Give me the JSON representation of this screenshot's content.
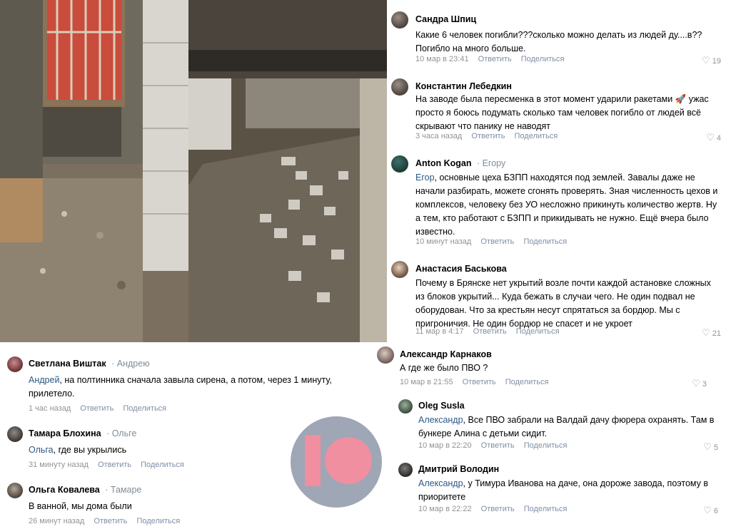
{
  "comments_right": [
    {
      "name": "Сандра Шпиц",
      "reply_to": "",
      "mention": "",
      "text": "Какие 6 человек погибли???сколько можно делать из людей ду....в?? Погибло на много больше.",
      "time": "10 мар в 23:41",
      "reply": "Ответить",
      "share": "Поделиться",
      "likes": "19"
    },
    {
      "name": "Константин Лебедкин",
      "reply_to": "",
      "mention": "",
      "text": "На заводе была пересменка в этот момент ударили ракетами 🚀 ужас просто я боюсь подумать сколько там человек погибло от людей всё скрывают что панику не наводят",
      "time": "3 часа назад",
      "reply": "Ответить",
      "share": "Поделиться",
      "likes": "4"
    },
    {
      "name": "Anton Kogan",
      "reply_to": "Егору",
      "mention": "Егор",
      "text": ", основные цеха БЗПП находятся под землей. Завалы даже не начали разбирать, можете сгонять проверять. Зная численность цехов и комплексов, человеку без УО несложно прикинуть количество жертв. Ну а тем, кто работают с БЗПП и прикидывать не нужно. Ещё вчера было известно.",
      "time": "10 минут назад",
      "reply": "Ответить",
      "share": "Поделиться",
      "likes": ""
    },
    {
      "name": "Анастасия Баськова",
      "reply_to": "",
      "mention": "",
      "text": "Почему в Брянске нет укрытий возле почти каждой астановке сложных из блоков укрытий... Куда бежать в случаи чего. Не один подвал не оборудован. Что за крестьян несут спрятаться за бордюр. Мы с пригроничия. Не один бордюр не спасет и не укроет",
      "time": "11 мар в 4:17",
      "reply": "Ответить",
      "share": "Поделиться",
      "likes": "21"
    },
    {
      "name": "Александр Карнаков",
      "reply_to": "",
      "mention": "",
      "text": "А где же было ПВО ?",
      "time": "10 мар в 21:55",
      "reply": "Ответить",
      "share": "Поделиться",
      "likes": "3"
    },
    {
      "name": "Oleg Susla",
      "reply_to": "",
      "mention": "Александр",
      "text": ", Все ПВО забрали на Валдай дачу фюрера охранять. Там в бункере Алина с детьми сидит.",
      "time": "10 мар в 22:20",
      "reply": "Ответить",
      "share": "Поделиться",
      "likes": "5"
    },
    {
      "name": "Дмитрий Володин",
      "reply_to": "",
      "mention": "Александр",
      "text": ", у Тимура Иванова на даче, она дороже завода, поэтому в приоритете",
      "time": "10 мар в 22:22",
      "reply": "Ответить",
      "share": "Поделиться",
      "likes": "6"
    }
  ],
  "comments_left": [
    {
      "name": "Светлана Виштак",
      "reply_to": "Андрею",
      "mention": "Андрей",
      "text": ", на полтинника сначала завыла сирена, а потом, через 1 минуту, прилетело.",
      "time": "1 час назад",
      "reply": "Ответить",
      "share": "Поделиться"
    },
    {
      "name": "Тамара Блохина",
      "reply_to": "Ольге",
      "mention": "Ольга",
      "text": ", где вы укрылись",
      "time": "31 минуту назад",
      "reply": "Ответить",
      "share": "Поделиться"
    },
    {
      "name": "Ольга Ковалева",
      "reply_to": "Тамаре",
      "mention": "",
      "text": "В ванной, мы дома были",
      "time": "26 минут назад",
      "reply": "Ответить",
      "share": "Поделиться"
    }
  ],
  "colors": {
    "logo_bg": "#9fa6b5",
    "logo_fg": "#f08fa0",
    "link": "#2a5885",
    "meta": "#939393"
  }
}
